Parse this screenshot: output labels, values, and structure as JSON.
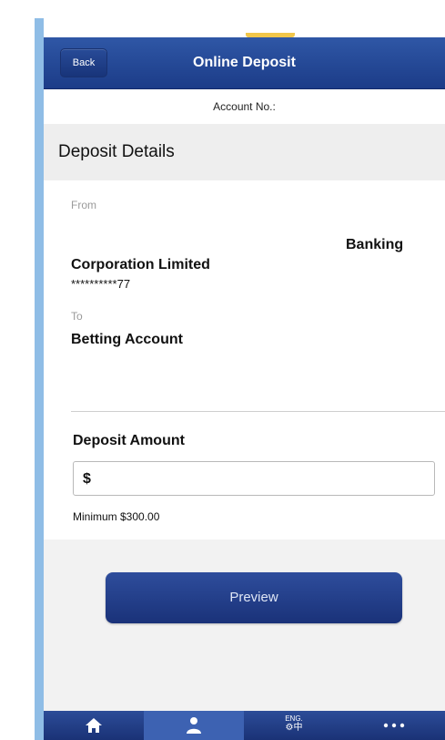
{
  "navbar": {
    "back_label": "Back",
    "title": "Online Deposit"
  },
  "account": {
    "label": "Account No.:"
  },
  "section": {
    "title": "Deposit Details"
  },
  "deposit": {
    "from_label": "From",
    "from_name_part1": "Banking",
    "from_name_part2": "Corporation Limited",
    "from_account_masked": "**********77",
    "to_label": "To",
    "to_name": "Betting Account",
    "amount_label": "Deposit Amount",
    "amount_value": "$",
    "minimum_note": "Minimum $300.00"
  },
  "actions": {
    "preview_label": "Preview"
  },
  "tabbar": {
    "active_index": 1,
    "tabs": [
      {
        "icon": "home-icon"
      },
      {
        "icon": "account-person-icon"
      },
      {
        "icon": "language-settings-icon",
        "text_top": "ENG.",
        "text_bottom": "⚙中"
      },
      {
        "icon": "more-icon",
        "text": "•••"
      }
    ]
  },
  "colors": {
    "primary": "#1c3c88",
    "frame": "#8fbde6",
    "notch": "#f1c64a"
  }
}
